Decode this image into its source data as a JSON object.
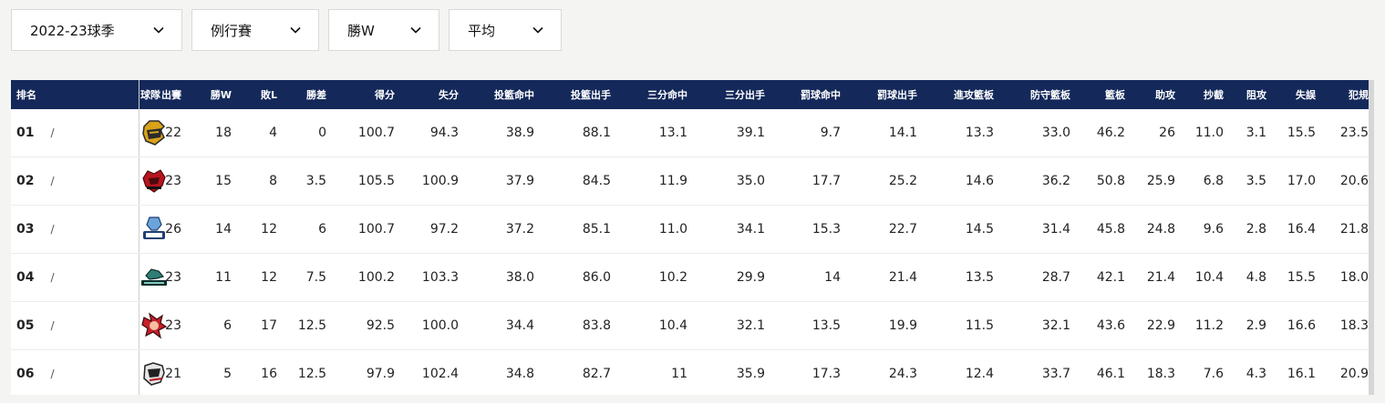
{
  "filters": [
    {
      "label": "2022-23球季"
    },
    {
      "label": "例行賽"
    },
    {
      "label": "勝W"
    },
    {
      "label": "平均"
    }
  ],
  "columns": [
    "排名",
    "球隊",
    "出賽",
    "勝W",
    "敗L",
    "勝差",
    "得分",
    "失分",
    "投籃命中",
    "投籃出手",
    "三分命中",
    "三分出手",
    "罰球命中",
    "罰球出手",
    "進攻籃板",
    "防守籃板",
    "籃板",
    "助攻",
    "抄截",
    "阻攻",
    "失誤",
    "犯規"
  ],
  "rows": [
    {
      "rank": "01",
      "slash": "/",
      "logo": "team-logo-1",
      "stats": [
        "22",
        "18",
        "4",
        "0",
        "100.7",
        "94.3",
        "38.9",
        "88.1",
        "13.1",
        "39.1",
        "9.7",
        "14.1",
        "13.3",
        "33.0",
        "46.2",
        "26",
        "11.0",
        "3.1",
        "15.5",
        "23.5"
      ]
    },
    {
      "rank": "02",
      "slash": "/",
      "logo": "team-logo-2",
      "stats": [
        "23",
        "15",
        "8",
        "3.5",
        "105.5",
        "100.9",
        "37.9",
        "84.5",
        "11.9",
        "35.0",
        "17.7",
        "25.2",
        "14.6",
        "36.2",
        "50.8",
        "25.9",
        "6.8",
        "3.5",
        "17.0",
        "20.6"
      ]
    },
    {
      "rank": "03",
      "slash": "/",
      "logo": "team-logo-aquas",
      "stats": [
        "26",
        "14",
        "12",
        "6",
        "100.7",
        "97.2",
        "37.2",
        "85.1",
        "11.0",
        "34.1",
        "15.3",
        "22.7",
        "14.5",
        "31.4",
        "45.8",
        "24.8",
        "9.6",
        "2.8",
        "16.4",
        "21.8"
      ]
    },
    {
      "rank": "04",
      "slash": "/",
      "logo": "team-logo-4",
      "stats": [
        "23",
        "11",
        "12",
        "7.5",
        "100.2",
        "103.3",
        "38.0",
        "86.0",
        "10.2",
        "29.9",
        "14",
        "21.4",
        "13.5",
        "28.7",
        "42.1",
        "21.4",
        "10.4",
        "4.8",
        "15.5",
        "18.0"
      ]
    },
    {
      "rank": "05",
      "slash": "/",
      "logo": "team-logo-5",
      "stats": [
        "23",
        "6",
        "17",
        "12.5",
        "92.5",
        "100.0",
        "34.4",
        "83.8",
        "10.4",
        "32.1",
        "13.5",
        "19.9",
        "11.5",
        "32.1",
        "43.6",
        "22.9",
        "11.2",
        "2.9",
        "16.6",
        "18.3"
      ]
    },
    {
      "rank": "06",
      "slash": "/",
      "logo": "team-logo-6",
      "stats": [
        "21",
        "5",
        "16",
        "12.5",
        "97.9",
        "102.4",
        "34.8",
        "82.7",
        "11",
        "35.9",
        "17.3",
        "24.3",
        "12.4",
        "33.7",
        "46.1",
        "18.3",
        "7.6",
        "4.3",
        "16.1",
        "20.9"
      ]
    }
  ],
  "colors": {
    "header_bg": "#14295a",
    "header_text": "#ffffff"
  }
}
